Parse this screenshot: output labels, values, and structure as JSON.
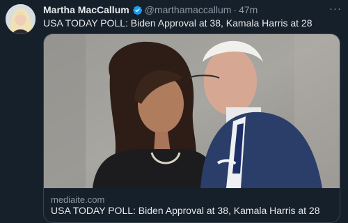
{
  "tweet": {
    "author_name": "Martha MacCallum",
    "handle": "@marthamaccallum",
    "separator": "·",
    "time": "47m",
    "more_label": "···",
    "text": "USA TODAY POLL: Biden Approval at 38, Kamala Harris at 28"
  },
  "card": {
    "domain": "mediaite.com",
    "title": "USA TODAY POLL: Biden Approval at 38, Kamala Harris at 28"
  },
  "colors": {
    "background": "#15202b",
    "verified": "#1d9bf0",
    "muted_text": "#8b98a5"
  },
  "icons": [
    "verified-badge-icon",
    "more-options-icon"
  ]
}
